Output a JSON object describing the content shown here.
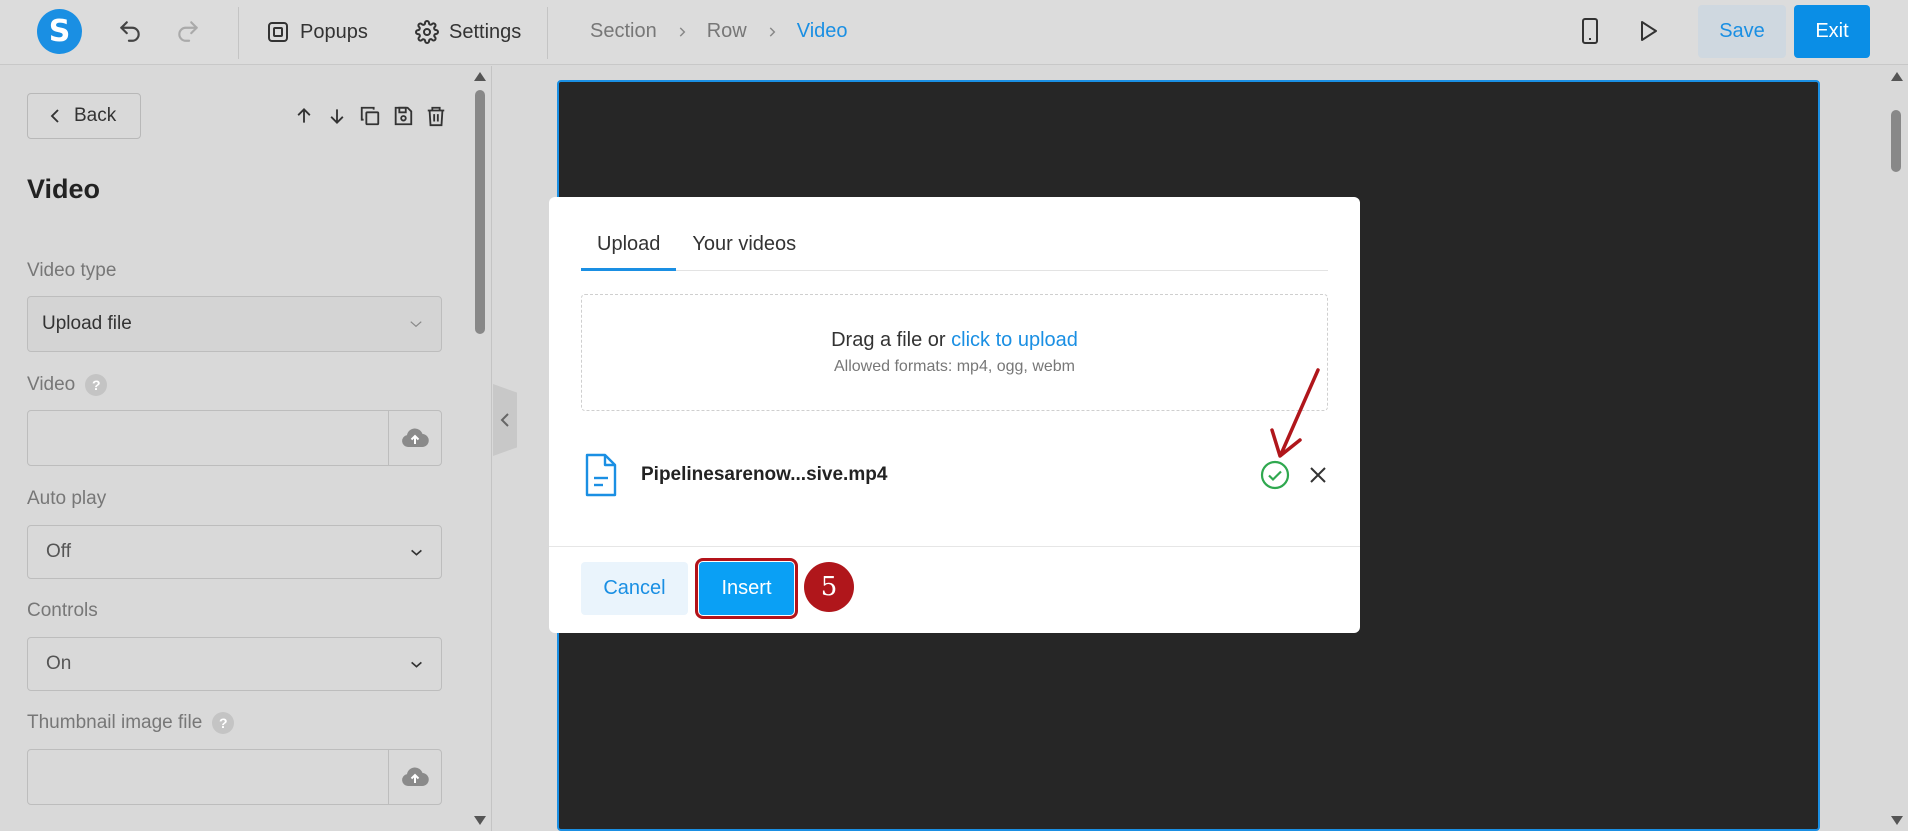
{
  "topbar": {
    "logo_letter": "S",
    "popups_label": "Popups",
    "settings_label": "Settings",
    "breadcrumb": [
      "Section",
      "Row",
      "Video"
    ],
    "save_label": "Save",
    "exit_label": "Exit"
  },
  "panel": {
    "back_label": "Back",
    "title": "Video",
    "video_type_label": "Video type",
    "video_type_value": "Upload file",
    "video_label": "Video",
    "autoplay_label": "Auto play",
    "autoplay_value": "Off",
    "controls_label": "Controls",
    "controls_value": "On",
    "thumbnail_label": "Thumbnail image file",
    "help_glyph": "?"
  },
  "modal": {
    "tabs": [
      "Upload",
      "Your videos"
    ],
    "dropzone_text": "Drag a file or ",
    "dropzone_link": "click to upload",
    "dropzone_formats": "Allowed formats: mp4, ogg, webm",
    "file_name": "Pipelinesarenow...sive.mp4",
    "cancel_label": "Cancel",
    "insert_label": "Insert"
  },
  "annotation": {
    "step_number": "5",
    "color": "#b0161b"
  },
  "colors": {
    "accent": "#1a8fe3",
    "insert_bg": "#0aa0f5",
    "success": "#2fa84f"
  }
}
